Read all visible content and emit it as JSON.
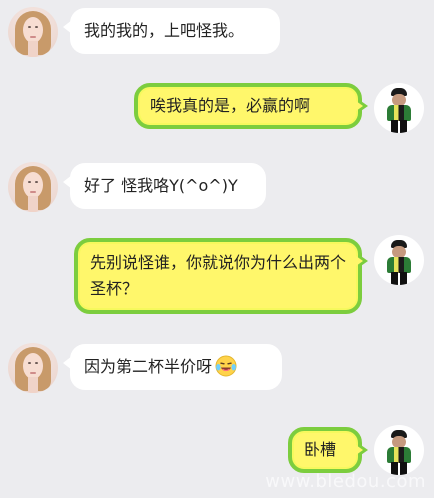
{
  "conversation": {
    "messages": [
      {
        "sender": "girl",
        "text": "我的我的，上吧怪我。"
      },
      {
        "sender": "boy",
        "text": "唉我真的是，必赢的啊"
      },
      {
        "sender": "girl",
        "text": "好了 怪我咯Y(^o^)Y"
      },
      {
        "sender": "boy",
        "text": "先别说怪谁，你就说你为什么出两个圣杯？"
      },
      {
        "sender": "girl",
        "text": "因为第二杯半价呀",
        "emoji": "laughing-with-tears-emoji"
      },
      {
        "sender": "boy",
        "text": "卧槽"
      }
    ]
  },
  "watermark": "www.bledou.com",
  "theme": {
    "background": "#ececef",
    "incoming_bubble": "#ffffff",
    "outgoing_bubble_fill": "#fff76b",
    "outgoing_bubble_border": "#7ccd3e"
  },
  "avatars": {
    "girl_icon": "girl-avatar-icon",
    "boy_icon": "boy-avatar-icon"
  }
}
